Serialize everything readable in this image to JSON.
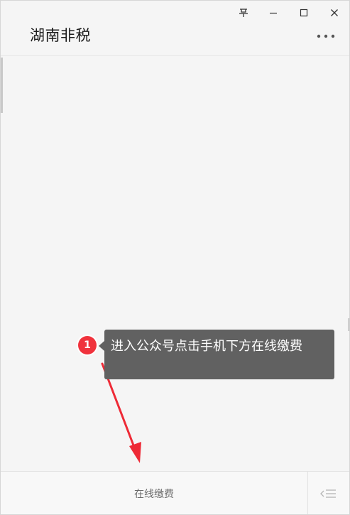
{
  "window": {
    "title": "湖南非税",
    "controls": {
      "pin_icon": "pin-icon",
      "minimize_icon": "minimize-icon",
      "maximize_icon": "maximize-icon",
      "close_icon": "close-icon"
    },
    "more_icon": "more-dots-icon"
  },
  "bottom_menu": {
    "item_label": "在线缴费",
    "keyboard_toggle_icon": "keyboard-toggle-icon"
  },
  "annotation": {
    "step_number": "1",
    "text": "进入公众号点击手机下方在线缴费",
    "colors": {
      "badge": "#f0323c",
      "tooltip_bg": "#616161",
      "arrow": "#ee2a36"
    }
  }
}
